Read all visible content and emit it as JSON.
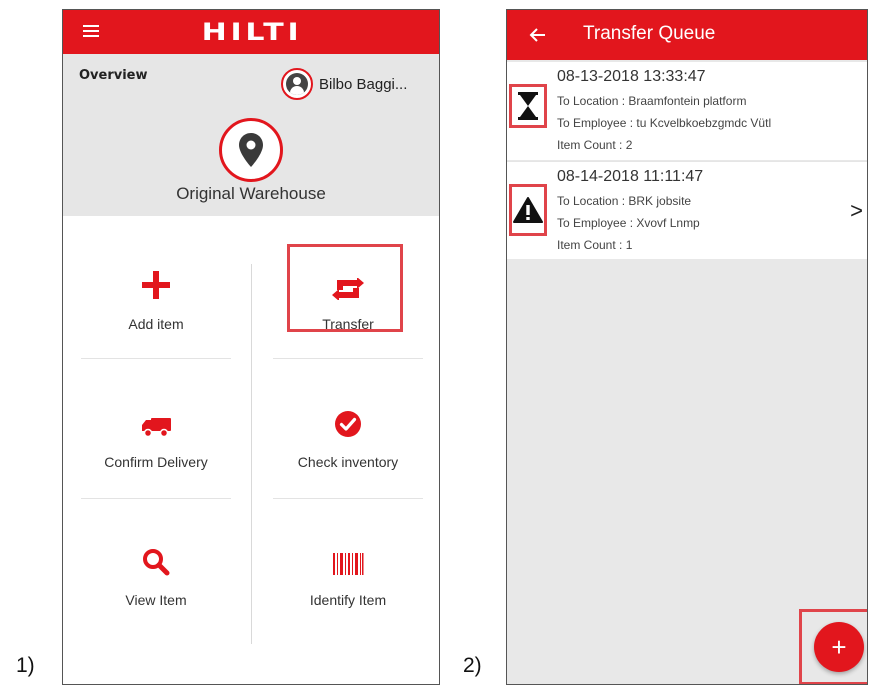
{
  "labels": {
    "first": "1)",
    "second": "2)"
  },
  "screen1": {
    "brand": "HILTI",
    "overview_title": "Overview",
    "user_name": "Bilbo Baggi...",
    "warehouse": "Original Warehouse",
    "tiles": {
      "add_item": "Add item",
      "transfer": "Transfer",
      "confirm_delivery": "Confirm Delivery",
      "check_inventory": "Check inventory",
      "view_item": "View Item",
      "identify_item": "Identify Item"
    }
  },
  "screen2": {
    "title": "Transfer Queue",
    "items": [
      {
        "date": "08-13-2018 13:33:47",
        "location": "To Location : Braamfontein platform",
        "employee": "To Employee : tu Kcvelbkoebzgmdc Vütl",
        "count": "Item Count : 2",
        "status_icon": "hourglass-icon"
      },
      {
        "date": "08-14-2018 11:11:47",
        "location": "To Location : BRK jobsite",
        "employee": "To Employee : Xvovf Lnmp",
        "count": "Item Count : 1",
        "status_icon": "warning-icon"
      }
    ],
    "chevron": ">",
    "fab": "+"
  },
  "colors": {
    "brand_red": "#e2161d",
    "highlight": "#e0444a",
    "overview_bg": "#e6e6e6",
    "queue_bg": "#e8e8e8"
  }
}
